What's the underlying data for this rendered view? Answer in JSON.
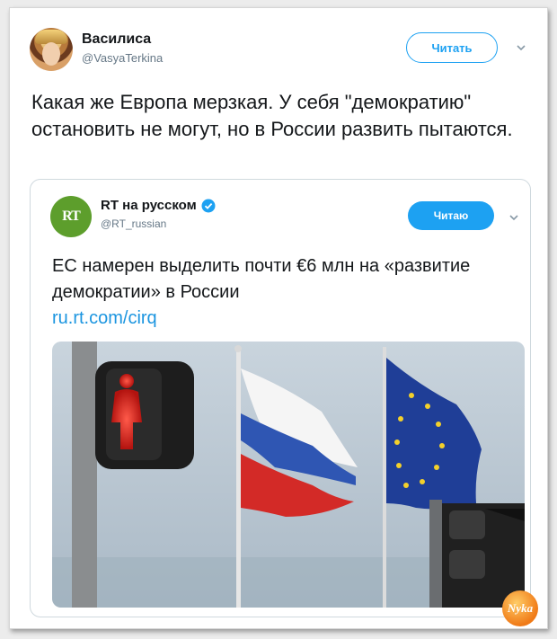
{
  "tweet": {
    "author_name": "Василиса",
    "author_handle": "@VasyaTerkina",
    "follow_label": "Читать",
    "text": "Какая же Европа мерзкая. У себя \"демократию\" остановить не могут, но в России развить пытаются."
  },
  "quoted": {
    "logo_text": "RT",
    "author_name": "RT на русском",
    "author_handle": "@RT_russian",
    "follow_label": "Читаю",
    "text": "ЕС намерен выделить почти €6 млн на «развитие демократии» в России",
    "link": "ru.rt.com/cirq",
    "image_desc": "flags"
  },
  "colors": {
    "accent": "#1da1f2",
    "link": "#1b95e0",
    "rt_green": "#5d9e2c"
  },
  "watermark": "Nyka"
}
